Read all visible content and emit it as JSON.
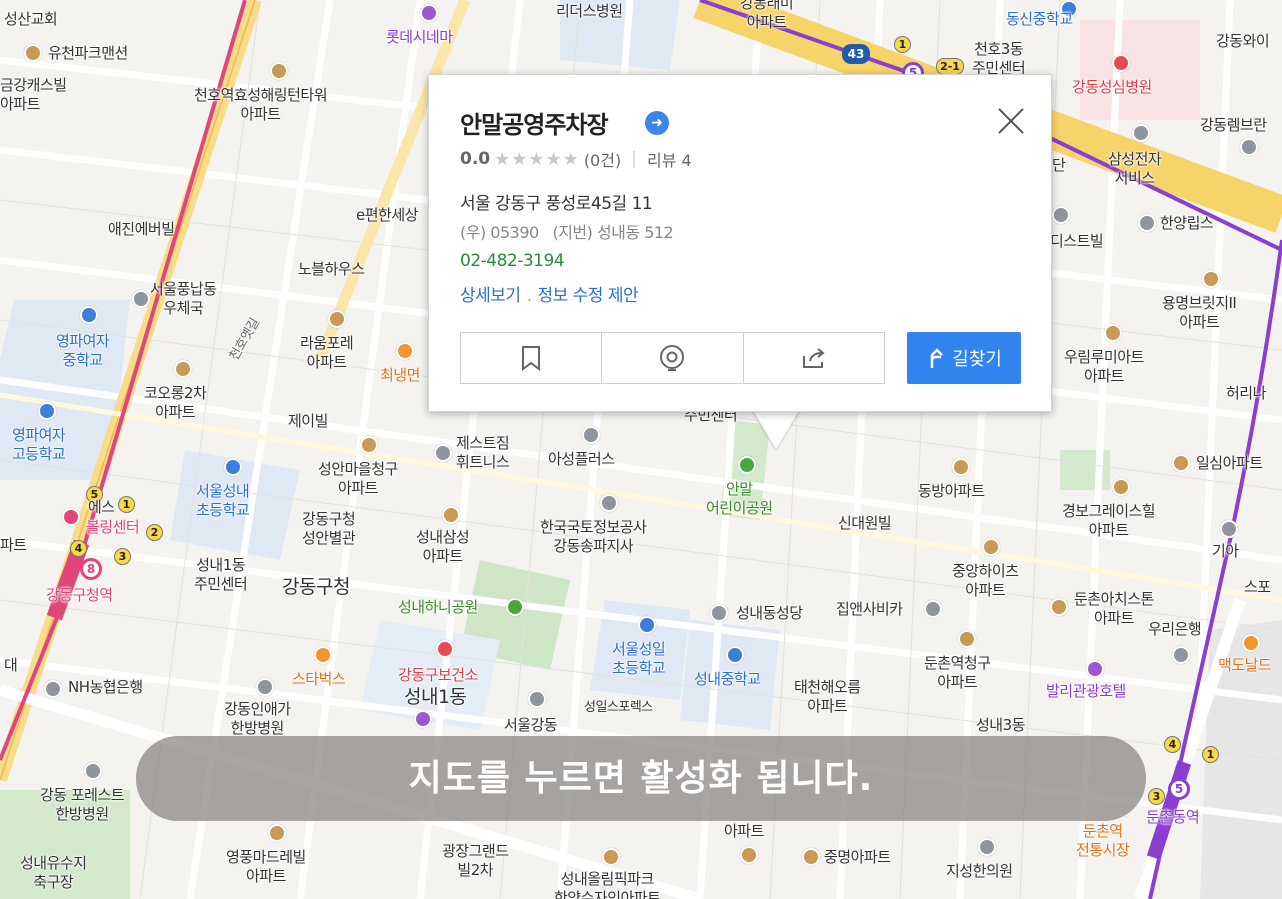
{
  "popup": {
    "title": "안말공영주차장",
    "rating_score": "0.0",
    "rating_stars": "★★★★★",
    "rating_count": "(0건)",
    "review_label": "리뷰 4",
    "address_road": "서울 강동구 풍성로45길 11",
    "address_postal": "(우) 05390   (지번) 성내동 512",
    "phone": "02-482-3194",
    "link_detail": "상세보기",
    "link_edit": "정보 수정 제안",
    "route_label": "길찾기",
    "icons": [
      "go-arrow-icon",
      "close-icon",
      "bookmark-icon",
      "location-icon",
      "share-icon",
      "route-icon"
    ]
  },
  "toast": {
    "text": "지도를 누르면 활성화 됩니다."
  },
  "road_number": "43",
  "stations": {
    "gangdong_gu": {
      "number": "8",
      "name": "강동구청역"
    },
    "dunchon": {
      "number": "5",
      "name": "둔촌동역"
    },
    "top": {
      "number": "5"
    }
  },
  "exits": [
    "1",
    "2",
    "3",
    "4",
    "5",
    "2-1"
  ],
  "labels": {
    "l1": "성산교회",
    "l2": "유천파크맨션",
    "l3": "금강캐스빌\n아파트",
    "l4": "천호역효성해링턴타워\n아파트",
    "l5": "롯데시네마",
    "l6": "리더스병원",
    "l7": "강동래미\n아파트",
    "l8": "동신중학교",
    "l9": "천호3동\n주민센터",
    "l10": "강동와이",
    "l11": "강동성심병원",
    "l12": "강동렘브란",
    "l13": "삼성전자\n서비스",
    "l14": "한양립스",
    "l15": "애진에버빌",
    "l16": "e편한세상",
    "l17": "노블하우스",
    "l18": "서울풍납동\n우체국",
    "l19": "라움포레\n아파트",
    "l20": "최냉면",
    "l21": "영파여자\n중학교",
    "l22": "코오롱2차\n아파트",
    "l23": "영파여자\n고등학교",
    "l24": "제이빌",
    "l25": "제스트짐\n휘트니스",
    "l26": "아성플러스",
    "l27": "성안마을청구\n아파트",
    "l28": "서울성내\n초등학교",
    "l29": "볼링센터",
    "l30": "강동구청\n성안별관",
    "l31": "성내1동\n주민센터",
    "l32": "강동구청",
    "l33": "성내삼성\n아파트",
    "l34": "한국국토정보공사\n강동송파지사",
    "l35": "안말\n어린이공원",
    "l36": "신대원빌",
    "l37": "주민센터",
    "l38": "동방아파트",
    "l39": "일심아파트",
    "l40": "경보그레이스힐\n아파트",
    "l41": "용명브릿지II\n아파트",
    "l42": "우림루미아트\n아파트",
    "l43": "허리나",
    "l44": "성내하니공원",
    "l45": "성내동성당",
    "l46": "집앤사비카",
    "l47": "중앙하이츠\n아파트",
    "l48": "둔촌아치스톤\n아파트",
    "l49": "우리은행",
    "l50": "기아",
    "l51": "스포",
    "l52": "서울성일\n초등학교",
    "l53": "성내중학교",
    "l54": "둔촌역청구\n아파트",
    "l55": "발리관광호텔",
    "l56": "맥도날드",
    "l57": "NH농협은행",
    "l58": "스타벅스",
    "l59": "강동구보건소",
    "l60": "성내1동",
    "l61": "강동인애가\n한방병원",
    "l62": "서울강동",
    "l63": "성일스포렉스",
    "l64": "태천해오름\n아파트",
    "l65": "성내3동",
    "l66": "강동 포레스트\n한방병원",
    "l67": "성내유수지\n축구장",
    "l68": "영풍마드레빌\n아파트",
    "l69": "광장그랜드\n빌2차",
    "l70": "성내올림픽파크\n한양수자인아파트",
    "l71": "중명아파트",
    "l72": "지성한의원",
    "l73": "둔촌역\n전통시장",
    "l74": "천호옛길",
    "l75": "대",
    "l76": "파트",
    "l77": "에스",
    "l78": "단",
    "l79": "디스트빌",
    "l80": "아파트"
  }
}
